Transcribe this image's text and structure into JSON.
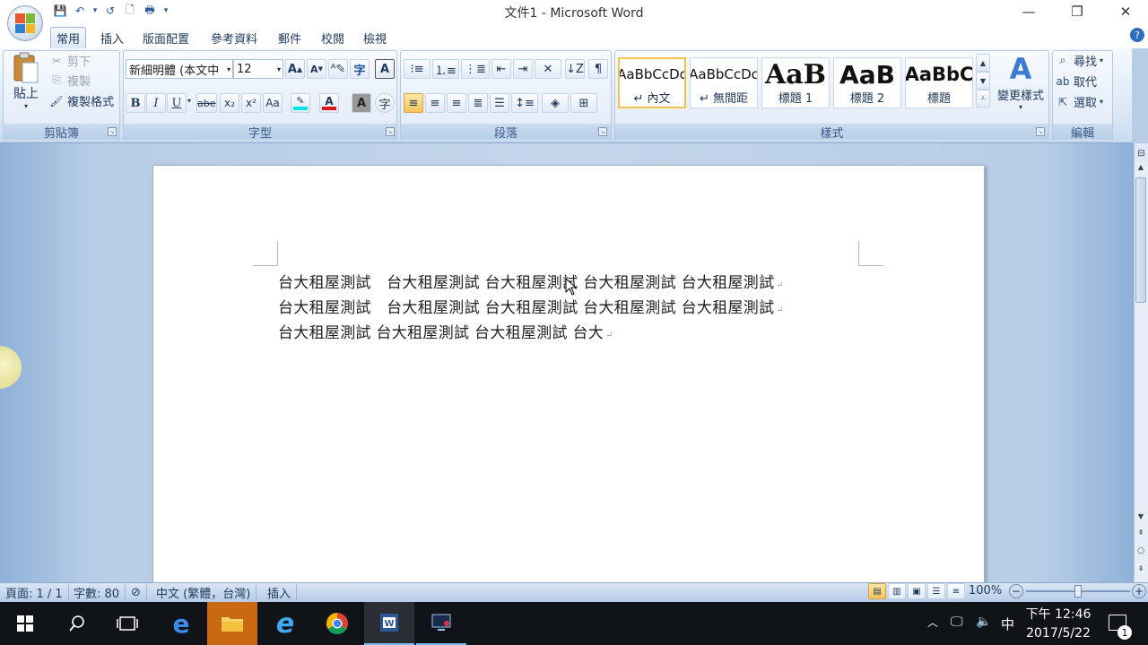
{
  "window": {
    "title": "文件1 - Microsoft Word",
    "minimize": "—",
    "restore": "❐",
    "close": "✕"
  },
  "qat": {
    "save": "💾",
    "undo": "↶",
    "redo": "↺",
    "preview": "🗋",
    "print": "🖶",
    "customize": "▾"
  },
  "tabs": [
    {
      "label": "常用",
      "active": true
    },
    {
      "label": "插入"
    },
    {
      "label": "版面配置"
    },
    {
      "label": "參考資料"
    },
    {
      "label": "郵件"
    },
    {
      "label": "校閱"
    },
    {
      "label": "檢視"
    }
  ],
  "help": "?",
  "clipboard": {
    "paste": "貼上",
    "cut": "剪下",
    "copy": "複製",
    "format_painter": "複製格式",
    "group": "剪貼簿"
  },
  "font": {
    "name": "新細明體 (本文中",
    "size": "12",
    "grow": "A",
    "shrink": "A",
    "group": "字型",
    "bold": "B",
    "italic": "I",
    "underline": "U",
    "strike": "abe",
    "subscript": "x₂",
    "superscript": "x²",
    "case": "Aa",
    "highlight_color": "#00e5e5",
    "font_color": "#e0161c"
  },
  "paragraph": {
    "group": "段落"
  },
  "styles": {
    "group": "樣式",
    "items": [
      {
        "sample": "AaBbCcDc",
        "name": "↵ 內文",
        "selected": true
      },
      {
        "sample": "AaBbCcDc",
        "name": "↵ 無間距"
      },
      {
        "sample": "AaB",
        "name": "標題 1"
      },
      {
        "sample": "AaB",
        "name": "標題 2"
      },
      {
        "sample": "AaBbC",
        "name": "標題"
      }
    ],
    "change": "變更樣式"
  },
  "editing": {
    "group": "編輯",
    "find": "尋找",
    "replace": "取代",
    "select": "選取"
  },
  "document": {
    "lines": [
      "台大租屋測試　台大租屋測試  台大租屋測試  台大租屋測試  台大租屋測試",
      "台大租屋測試　台大租屋測試  台大租屋測試  台大租屋測試  台大租屋測試",
      "台大租屋測試  台大租屋測試  台大租屋測試  台大"
    ]
  },
  "status": {
    "page": "頁面: 1 / 1",
    "words": "字數: 80",
    "language": "中文 (繁體，台灣)",
    "mode": "插入",
    "zoom": "100%",
    "zoom_out": "−",
    "zoom_in": "+"
  },
  "taskbar": {
    "time": "下午 12:46",
    "date": "2017/5/22",
    "ime": "中",
    "notifications": "1"
  }
}
